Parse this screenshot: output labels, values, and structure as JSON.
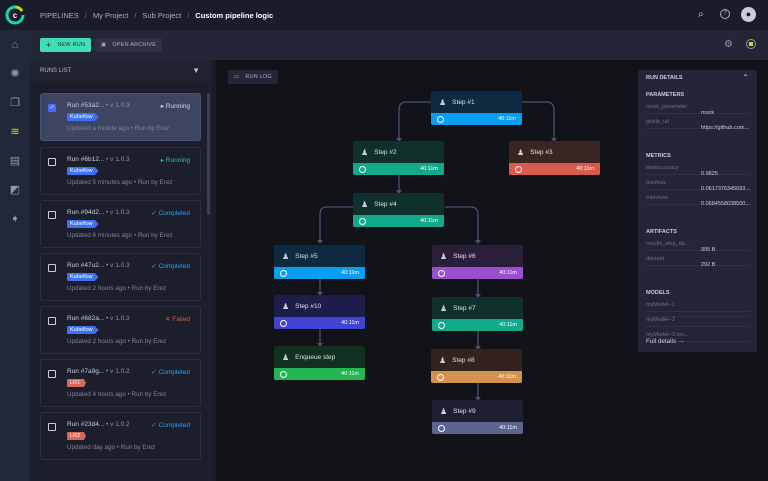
{
  "breadcrumb": {
    "root": "PIPELINES",
    "project": "My Project",
    "sub": "Sub Project",
    "current": "Custom pipeline logic"
  },
  "toolbar": {
    "new_run": "NEW RUN",
    "open_archive": "OPEN ARCHIVE",
    "run_log": "RUN LOG"
  },
  "runs_list": {
    "title": "RUNS LIST",
    "runs": [
      {
        "id": "Run #53a2...",
        "version": "v 1.0.3",
        "status": "Running",
        "status_color": "#d6d9e6",
        "tag": "Kubeflow",
        "tag_color": "#3f72f0",
        "updated": "Updated a minute ago",
        "by": "Run by Erez",
        "selected": true
      },
      {
        "id": "Run #6b12...",
        "version": "v 1.0.3",
        "status": "Running",
        "status_color": "#2bc4a0",
        "tag": "Kubeflow",
        "tag_color": "#3f72f0",
        "updated": "Updated 5 minutes ago",
        "by": "Run by Erez",
        "selected": false
      },
      {
        "id": "Run #94d2...",
        "version": "v 1.0.3",
        "status": "Completed",
        "status_color": "#2a9df4",
        "tag": "Kubeflow",
        "tag_color": "#3f72f0",
        "updated": "Updated 6 minutes ago",
        "by": "Run by Erez",
        "selected": false
      },
      {
        "id": "Run #47u2...",
        "version": "v 1.0.3",
        "status": "Completed",
        "status_color": "#2a9df4",
        "tag": "Kubeflow",
        "tag_color": "#3f72f0",
        "updated": "Updated 2 hours ago",
        "by": "Run by Erez",
        "selected": false
      },
      {
        "id": "Run #682a...",
        "version": "v 1.0.3",
        "status": "Failed",
        "status_color": "#e0554a",
        "tag": "Kubeflow",
        "tag_color": "#3f72f0",
        "updated": "Updated 2 hours ago",
        "by": "Run by Erez",
        "selected": false
      },
      {
        "id": "Run #7a9g...",
        "version": "v 1.0.2",
        "status": "Completed",
        "status_color": "#2a9df4",
        "tag": "LR1",
        "tag_color": "#d9665a",
        "updated": "Updated 4 hours ago",
        "by": "Run by Erez",
        "selected": false
      },
      {
        "id": "Run #23d4...",
        "version": "v 1.0.2",
        "status": "Completed",
        "status_color": "#2a9df4",
        "tag": "LR2",
        "tag_color": "#d9665a",
        "updated": "Updated day ago",
        "by": "Run by Erez",
        "selected": false
      }
    ]
  },
  "pipeline": {
    "steps": [
      {
        "label": "Step #1",
        "duration": "40:11m",
        "header_color": "#0d2a40",
        "status_color": "#0a9ef0"
      },
      {
        "label": "Step #2",
        "duration": "40:11m",
        "header_color": "#10302c",
        "status_color": "#14a98a"
      },
      {
        "label": "Step #3",
        "duration": "40:11m",
        "header_color": "#3a2522",
        "status_color": "#d95a4f"
      },
      {
        "label": "Step #4",
        "duration": "40:11m",
        "header_color": "#10302c",
        "status_color": "#14a98a"
      },
      {
        "label": "Step #5",
        "duration": "40:11m",
        "header_color": "#0d2a40",
        "status_color": "#0a9ef0"
      },
      {
        "label": "Step #6",
        "duration": "40:11m",
        "header_color": "#2a1f3a",
        "status_color": "#9b4fcf"
      },
      {
        "label": "Step #10",
        "duration": "40:11m",
        "header_color": "#1c1d4a",
        "status_color": "#4143d4"
      },
      {
        "label": "Step #7",
        "duration": "40:11m",
        "header_color": "#10302c",
        "status_color": "#14a98a"
      },
      {
        "label": "Enqueue step",
        "duration": "40:11m",
        "header_color": "#123020",
        "status_color": "#22b551"
      },
      {
        "label": "Step #8",
        "duration": "40:11m",
        "header_color": "#33231c",
        "status_color": "#d4924f"
      },
      {
        "label": "Step #9",
        "duration": "40:11m",
        "header_color": "#1c2030",
        "status_color": "#5b6590"
      }
    ]
  },
  "details": {
    "title": "RUN DETAILS",
    "parameters": {
      "title": "PARAMETERS",
      "rows": [
        {
          "k": "mock_parameter",
          "v": "mock"
        },
        {
          "k": "pickle_url",
          "v": "https://github.com..."
        }
      ]
    },
    "metrics": {
      "title": "METRICS",
      "rows": [
        {
          "k": "test/accuracy",
          "v": "0.9825"
        },
        {
          "k": "test/loss",
          "v": "0.0617376345693..."
        },
        {
          "k": "train/loss",
          "v": "0.0684558038500..."
        }
      ]
    },
    "artifacts": {
      "title": "ARTIFACTS",
      "rows": [
        {
          "k": "results_step_da...",
          "v": "995 B"
        },
        {
          "k": "dataset",
          "v": "292 B"
        }
      ]
    },
    "models": {
      "title": "MODELS",
      "rows": [
        {
          "k": "myModel--1",
          "v": ""
        },
        {
          "k": "myModel--2",
          "v": ""
        },
        {
          "k": "myModel--3 lon...",
          "v": ""
        }
      ]
    },
    "full_details": "Full details →"
  }
}
